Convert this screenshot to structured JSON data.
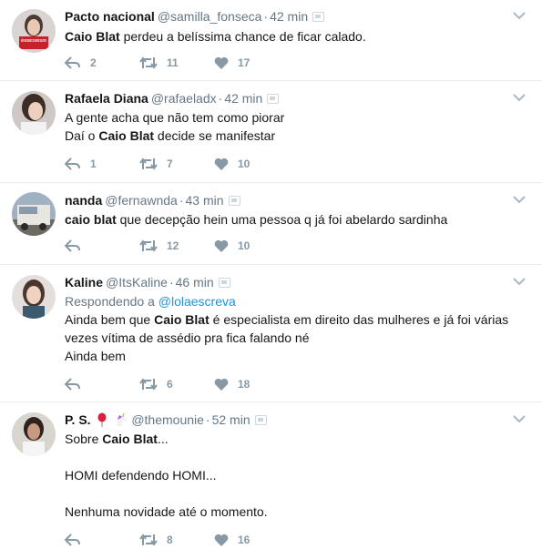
{
  "tweets": [
    {
      "name": "Pacto nacional",
      "handle": "@samilla_fonseca",
      "time": "42 min",
      "avatar_badge": "NÃO RECONHECO GOVERNO GOLPISTA",
      "lines": [
        [
          {
            "t": "Caio Blat",
            "b": true
          },
          {
            "t": " perdeu a belíssima chance de ficar calado.",
            "b": false
          }
        ]
      ],
      "replies": "2",
      "retweets": "11",
      "likes": "17"
    },
    {
      "name": "Rafaela Diana",
      "handle": "@rafaeladx",
      "time": "42 min",
      "lines": [
        [
          {
            "t": "A gente acha que não tem como piorar",
            "b": false
          }
        ],
        [
          {
            "t": "Daí o ",
            "b": false
          },
          {
            "t": "Caio Blat",
            "b": true
          },
          {
            "t": " decide se manifestar",
            "b": false
          }
        ]
      ],
      "replies": "1",
      "retweets": "7",
      "likes": "10"
    },
    {
      "name": "nanda",
      "handle": "@fernawnda",
      "time": "43 min",
      "lines": [
        [
          {
            "t": "caio blat",
            "b": true
          },
          {
            "t": " que decepção hein uma pessoa q já foi abelardo sardinha",
            "b": false
          }
        ]
      ],
      "replies": "",
      "retweets": "12",
      "likes": "10"
    },
    {
      "name": "Kaline",
      "handle": "@ItsKaline",
      "time": "46 min",
      "replying_label": "Respondendo a ",
      "replying_handle": "@lolaescreva",
      "lines": [
        [
          {
            "t": "Ainda bem que ",
            "b": false
          },
          {
            "t": "Caio Blat",
            "b": true
          },
          {
            "t": " é especialista em direito das mulheres e já foi várias",
            "b": false
          }
        ],
        [
          {
            "t": "vezes vítima de assédio pra fica falando né",
            "b": false
          }
        ],
        [
          {
            "t": "Ainda bem",
            "b": false
          }
        ]
      ],
      "replies": "",
      "retweets": "6",
      "likes": "18"
    },
    {
      "name": "P. S.",
      "handle": "@themounie",
      "time": "52 min",
      "name_emojis": [
        "balloon-emoji",
        "unicorn-emoji"
      ],
      "lines": [
        [
          {
            "t": "Sobre ",
            "b": false
          },
          {
            "t": "Caio Blat",
            "b": true
          },
          {
            "t": "...",
            "b": false
          }
        ],
        [],
        [
          {
            "t": "HOMI defendendo HOMI...",
            "b": false
          }
        ],
        [],
        [
          {
            "t": "Nenhuma novidade até o momento.",
            "b": false
          }
        ]
      ],
      "replies": "",
      "retweets": "8",
      "likes": "16"
    }
  ],
  "colors": {
    "text": "#14171a",
    "muted": "#657786",
    "icon": "#8899a6",
    "link": "#1b95e0",
    "border": "#e6ecf0"
  },
  "icons": [
    "reply-icon",
    "retweet-icon",
    "heart-icon",
    "chevron-down-icon",
    "device-icon"
  ]
}
